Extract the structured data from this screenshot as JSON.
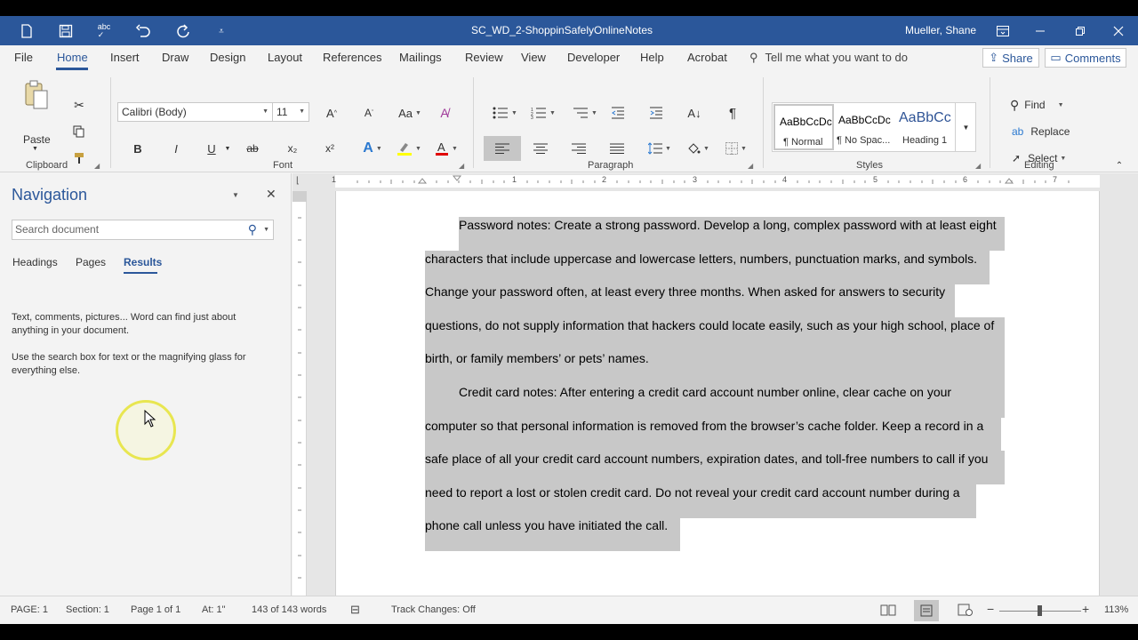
{
  "title_bar": {
    "document_title": "SC_WD_2-ShoppinSafelyOnlineNotes",
    "user": "Mueller, Shane",
    "qat_icons": [
      "new-document-icon",
      "save-icon",
      "spelling-icon",
      "undo-icon",
      "redo-icon",
      "customize-qat-icon"
    ],
    "window_icons": [
      "ribbon-display-options-icon",
      "minimize-icon",
      "restore-icon",
      "close-icon"
    ]
  },
  "menu": {
    "tabs": [
      "File",
      "Home",
      "Insert",
      "Draw",
      "Design",
      "Layout",
      "References",
      "Mailings",
      "Review",
      "View",
      "Developer",
      "Help",
      "Acrobat"
    ],
    "active_tab": "Home",
    "tell_me": "Tell me what you want to do",
    "share": "Share",
    "comments": "Comments"
  },
  "ribbon": {
    "clipboard": {
      "label": "Clipboard",
      "paste": "Paste"
    },
    "font": {
      "label": "Font",
      "font_name": "Calibri (Body)",
      "font_size": "11",
      "bold": "B",
      "italic": "I",
      "underline": "U",
      "strike": "ab",
      "subscript": "x₂",
      "superscript": "x²"
    },
    "paragraph": {
      "label": "Paragraph",
      "pilcrow": "¶"
    },
    "styles": {
      "label": "Styles",
      "items": [
        {
          "preview": "AaBbCcDc",
          "name": "¶ Normal"
        },
        {
          "preview": "AaBbCcDc",
          "name": "¶ No Spac..."
        },
        {
          "preview": "AaBbCc",
          "name": "Heading 1"
        }
      ]
    },
    "editing": {
      "label": "Editing",
      "find": "Find",
      "replace": "Replace",
      "select": "Select"
    },
    "colors": {
      "highlight": "#ffff00",
      "font_color": "#e00000",
      "accent": "#2b579a"
    }
  },
  "navigation": {
    "title": "Navigation",
    "search_placeholder": "Search document",
    "tabs": [
      "Headings",
      "Pages",
      "Results"
    ],
    "active_tab": "Results",
    "help_text_1": "Text, comments, pictures... Word can find just about anything in your document.",
    "help_text_2": "Use the search box for text or the magnifying glass for everything else."
  },
  "document": {
    "ruler_numbers": [
      "1",
      "1",
      "2",
      "3",
      "4",
      "5",
      "6",
      "7"
    ],
    "paragraph1_lines": [
      "Password notes: Create a strong password. Develop a long, complex password with at least eight",
      "characters that include uppercase and lowercase letters, numbers, punctuation marks, and symbols.",
      "Change your password often, at least every three months. When asked for answers to security",
      "questions, do not supply information that hackers could locate easily, such as your high school, place of",
      "birth, or family members’ or pets’ names."
    ],
    "paragraph2_lines": [
      "Credit card notes: After entering a credit card account number online, clear cache on your",
      "computer so that personal information is removed from the browser’s cache folder. Keep a record in a",
      "safe place of all your credit card account numbers, expiration dates, and toll-free numbers to call if you",
      "need to report a lost or stolen credit card. Do not reveal your credit card account number during a",
      "phone call unless you have initiated the call."
    ]
  },
  "status": {
    "page": "PAGE: 1",
    "section": "Section: 1",
    "page_of": "Page 1 of 1",
    "at": "At: 1\"",
    "words": "143 of 143 words",
    "track_changes": "Track Changes: Off",
    "zoom": "113%"
  }
}
